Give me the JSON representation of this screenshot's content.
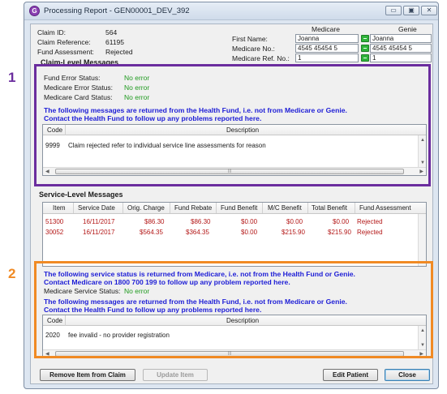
{
  "window": {
    "title": "Processing Report - GEN00001_DEV_392",
    "minimize": "▭",
    "maximize": "▣",
    "close": "✕"
  },
  "claim": {
    "claim_id_label": "Claim ID:",
    "claim_id": "564",
    "claim_ref_label": "Claim Reference:",
    "claim_ref": "61195",
    "fund_assessment_label": "Fund Assessment:",
    "fund_assessment": "Rejected"
  },
  "patient": {
    "medicare_header": "Medicare",
    "genie_header": "Genie",
    "first_name_label": "First Name:",
    "medicare_no_label": "Medicare No.:",
    "medicare_ref_label": "Medicare Ref. No.:",
    "medicare_first_name": "Joanna",
    "medicare_no": "4545 45454 5",
    "medicare_ref": "1",
    "genie_first_name": "Joanna",
    "genie_medicare_no": "4545 45454 5",
    "genie_ref": "1"
  },
  "claim_level": {
    "title": "Claim-Level Messages",
    "fund_error_label": "Fund Error Status:",
    "fund_error_value": "No error",
    "medicare_error_label": "Medicare Error Status:",
    "medicare_error_value": "No error",
    "medicare_card_label": "Medicare Card Status:",
    "medicare_card_value": "No error",
    "notice_line1": "The following messages are returned from the Health Fund, i.e. not from Medicare or Genie.",
    "notice_line2": "Contact the Health Fund to follow up any problems reported here.",
    "grid": {
      "col_code": "Code",
      "col_description": "Description",
      "rows": [
        {
          "code": "9999",
          "description": "Claim rejected refer to individual service line assessments for reason"
        }
      ]
    }
  },
  "service_level": {
    "title": "Service-Level Messages",
    "columns": [
      "Item",
      "Service Date",
      "Orig. Charge",
      "Fund Rebate",
      "Fund Benefit",
      "M/C Benefit",
      "Total Benefit",
      "Fund Assessment"
    ],
    "rows": [
      {
        "item": "51300",
        "date": "16/11/2017",
        "orig": "$86.30",
        "rebate": "$86.30",
        "fund_benefit": "$0.00",
        "mc_benefit": "$0.00",
        "total": "$0.00",
        "assessment": "Rejected"
      },
      {
        "item": "30052",
        "date": "16/11/2017",
        "orig": "$564.35",
        "rebate": "$364.35",
        "fund_benefit": "$0.00",
        "mc_benefit": "$215.90",
        "total": "$215.90",
        "assessment": "Rejected"
      }
    ]
  },
  "service_status": {
    "notice_line1": "The following service status is returned from Medicare, i.e. not from the Health Fund or Genie.",
    "notice_line2": "Contact Medicare on 1800 700 199 to follow up any problem reported here.",
    "status_label": "Medicare Service Status:",
    "status_value": "No error",
    "fund_notice_line1": "The following messages are returned from the Health Fund, i.e. not from Medicare or Genie.",
    "fund_notice_line2": "Contact the Health Fund to follow up any problems reported here.",
    "grid": {
      "col_code": "Code",
      "col_description": "Description",
      "rows": [
        {
          "code": "2020",
          "description": "fee invalid - no provider registration"
        }
      ]
    }
  },
  "markers": {
    "one": "1",
    "two": "2"
  },
  "buttons": {
    "remove_item": "Remove Item from Claim",
    "update_item": "Update Item",
    "edit_patient": "Edit Patient",
    "close": "Close"
  },
  "colors": {
    "highlight_1": "#6b2d9e",
    "highlight_2": "#f08a24",
    "ok_text": "#1f9a1f",
    "notice_text": "#1d1dd6",
    "error_row_text": "#b31717"
  }
}
